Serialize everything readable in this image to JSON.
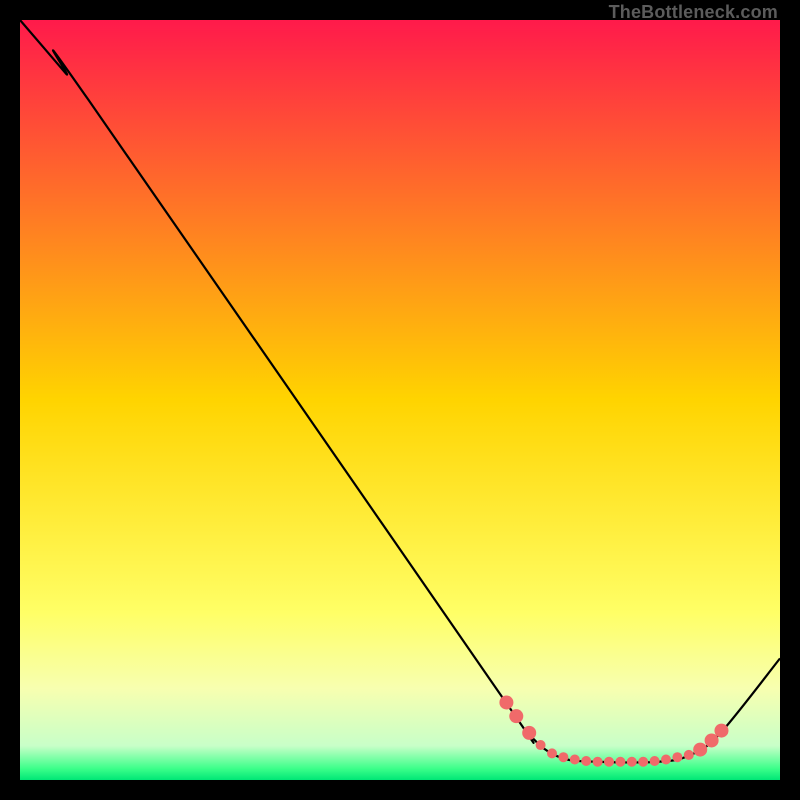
{
  "attribution": "TheBottleneck.com",
  "chart_data": {
    "type": "line",
    "title": "",
    "xlabel": "",
    "ylabel": "",
    "xlim": [
      0,
      100
    ],
    "ylim": [
      0,
      100
    ],
    "background_gradient": {
      "stops": [
        {
          "offset": 0.0,
          "color": "#ff1a4b"
        },
        {
          "offset": 0.5,
          "color": "#ffd400"
        },
        {
          "offset": 0.78,
          "color": "#ffff66"
        },
        {
          "offset": 0.88,
          "color": "#f7ffb0"
        },
        {
          "offset": 0.955,
          "color": "#c8ffc8"
        },
        {
          "offset": 0.985,
          "color": "#3cff8a"
        },
        {
          "offset": 1.0,
          "color": "#00e676"
        }
      ]
    },
    "series": [
      {
        "name": "bottleneck-curve",
        "color": "#000000",
        "points": [
          {
            "x": 0.0,
            "y": 100.0
          },
          {
            "x": 6.0,
            "y": 93.0
          },
          {
            "x": 9.0,
            "y": 89.5
          },
          {
            "x": 62.0,
            "y": 13.0
          },
          {
            "x": 67.0,
            "y": 6.0
          },
          {
            "x": 71.0,
            "y": 3.0
          },
          {
            "x": 76.0,
            "y": 2.4
          },
          {
            "x": 84.0,
            "y": 2.4
          },
          {
            "x": 88.0,
            "y": 3.2
          },
          {
            "x": 92.0,
            "y": 6.0
          },
          {
            "x": 100.0,
            "y": 16.0
          }
        ]
      }
    ],
    "markers": {
      "name": "highlight-dots",
      "color": "#f06a6a",
      "radius_big": 7,
      "radius_small": 5,
      "points": [
        {
          "x": 64.0,
          "y": 10.2,
          "r": "big"
        },
        {
          "x": 65.3,
          "y": 8.4,
          "r": "big"
        },
        {
          "x": 67.0,
          "y": 6.2,
          "r": "big"
        },
        {
          "x": 68.5,
          "y": 4.6,
          "r": "small"
        },
        {
          "x": 70.0,
          "y": 3.5,
          "r": "small"
        },
        {
          "x": 71.5,
          "y": 3.0,
          "r": "small"
        },
        {
          "x": 73.0,
          "y": 2.7,
          "r": "small"
        },
        {
          "x": 74.5,
          "y": 2.5,
          "r": "small"
        },
        {
          "x": 76.0,
          "y": 2.4,
          "r": "small"
        },
        {
          "x": 77.5,
          "y": 2.4,
          "r": "small"
        },
        {
          "x": 79.0,
          "y": 2.4,
          "r": "small"
        },
        {
          "x": 80.5,
          "y": 2.4,
          "r": "small"
        },
        {
          "x": 82.0,
          "y": 2.4,
          "r": "small"
        },
        {
          "x": 83.5,
          "y": 2.5,
          "r": "small"
        },
        {
          "x": 85.0,
          "y": 2.7,
          "r": "small"
        },
        {
          "x": 86.5,
          "y": 3.0,
          "r": "small"
        },
        {
          "x": 88.0,
          "y": 3.3,
          "r": "small"
        },
        {
          "x": 89.5,
          "y": 4.0,
          "r": "big"
        },
        {
          "x": 91.0,
          "y": 5.2,
          "r": "big"
        },
        {
          "x": 92.3,
          "y": 6.5,
          "r": "big"
        }
      ]
    }
  }
}
